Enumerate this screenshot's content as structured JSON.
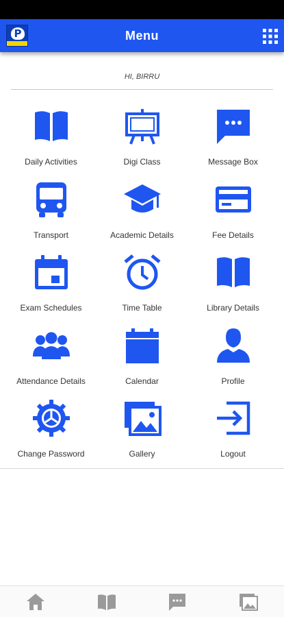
{
  "app_bar": {
    "title": "Menu",
    "logo_text": "P",
    "menu_icon": "grid-icon"
  },
  "greeting": "HI, BIRRU",
  "accent_color": "#1f56f0",
  "menu": [
    {
      "label": "Daily Activities",
      "icon": "book-icon"
    },
    {
      "label": "Digi Class",
      "icon": "easel-icon"
    },
    {
      "label": "Message Box",
      "icon": "message-icon"
    },
    {
      "label": "Transport",
      "icon": "bus-icon"
    },
    {
      "label": "Academic Details",
      "icon": "graduation-cap-icon"
    },
    {
      "label": "Fee Details",
      "icon": "credit-card-icon"
    },
    {
      "label": "Exam Schedules",
      "icon": "calendar-event-icon"
    },
    {
      "label": "Time Table",
      "icon": "alarm-clock-icon"
    },
    {
      "label": "Library Details",
      "icon": "library-book-icon"
    },
    {
      "label": "Attendance Details",
      "icon": "people-icon"
    },
    {
      "label": "Calendar",
      "icon": "calendar-icon"
    },
    {
      "label": "Profile",
      "icon": "person-icon"
    },
    {
      "label": "Change Password",
      "icon": "settings-wheel-icon"
    },
    {
      "label": "Gallery",
      "icon": "gallery-icon"
    },
    {
      "label": "Logout",
      "icon": "logout-icon"
    }
  ],
  "bottom_nav": [
    {
      "icon": "home-icon"
    },
    {
      "icon": "book-icon"
    },
    {
      "icon": "message-icon"
    },
    {
      "icon": "gallery-icon"
    }
  ]
}
